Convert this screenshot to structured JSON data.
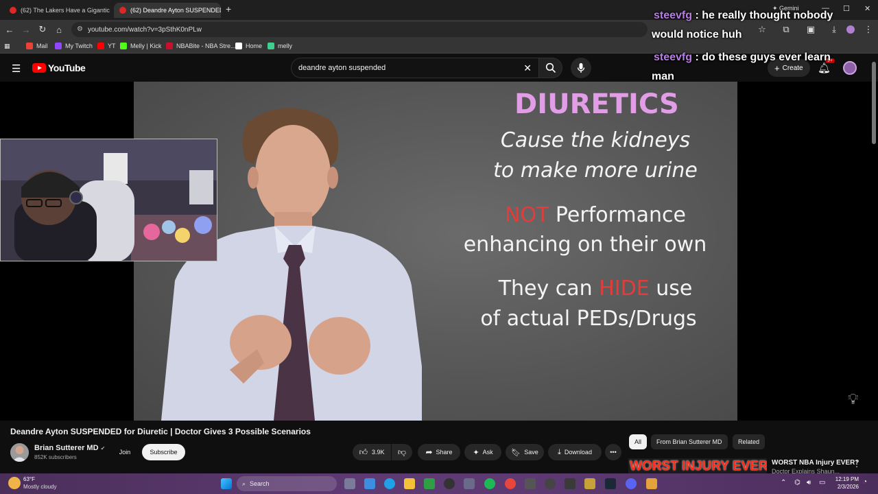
{
  "browser": {
    "tabs": [
      {
        "title": "(62) The Lakers Have a Gigantic",
        "active": false
      },
      {
        "title": "(62) Deandre Ayton SUSPENDED",
        "active": true
      }
    ],
    "new_tab": "+",
    "url": "youtube.com/watch?v=3pSthK0nPLw",
    "gemini_label": "Gemini",
    "bookmarks": [
      {
        "label": "Mail",
        "color": "#ea4335"
      },
      {
        "label": "My Twitch",
        "color": "#9146ff"
      },
      {
        "label": "YT",
        "color": "#ff0000"
      },
      {
        "label": "Melly | Kick",
        "color": "#53fc18"
      },
      {
        "label": "NBABite - NBA Stre...",
        "color": "#c8102e"
      },
      {
        "label": "Home",
        "color": "#ffffff"
      },
      {
        "label": "melly",
        "color": "#3ecf8e"
      }
    ]
  },
  "youtube": {
    "logo_text": "YouTube",
    "search_query": "deandre ayton suspended",
    "create_label": "Create",
    "notification_badge": "9+"
  },
  "slide": {
    "heading": "DIURETICS",
    "line1": "Cause the kidneys",
    "line2": "to make more urine",
    "not_word": "NOT",
    "line3_rest": " Performance",
    "line4": "enhancing on their own",
    "line5_a": "They can ",
    "hide_word": "HIDE",
    "line5_b": " use",
    "line6": "of actual PEDs/Drugs"
  },
  "chat": [
    {
      "user": "steevfg",
      "message": " : he really thought nobody",
      "cont": "would notice huh"
    },
    {
      "user": "steevfg",
      "message": " : do these guys ever learn",
      "cont": "man"
    }
  ],
  "video": {
    "title": "Deandre Ayton SUSPENDED for Diuretic | Doctor Gives 3 Possible Scenarios",
    "channel": "Brian Sutterer MD",
    "subscribers": "852K subscribers",
    "join_label": "Join",
    "subscribe_label": "Subscribe",
    "likes": "3.9K",
    "share_label": "Share",
    "ask_label": "Ask",
    "save_label": "Save",
    "download_label": "Download",
    "more_label": "•••"
  },
  "sidebar": {
    "chips": [
      "All",
      "From Brian Sutterer MD",
      "Related"
    ],
    "rec_thumb_text": "WORST INJURY EVER?",
    "rec_title": "WORST NBA Injury EVER?",
    "rec_sub": "Doctor Explains Shaun..."
  },
  "taskbar": {
    "temp": "63°F",
    "weather": "Mostly cloudy",
    "search_label": "Search",
    "time": "12:19 PM",
    "date": "2/3/2026"
  }
}
